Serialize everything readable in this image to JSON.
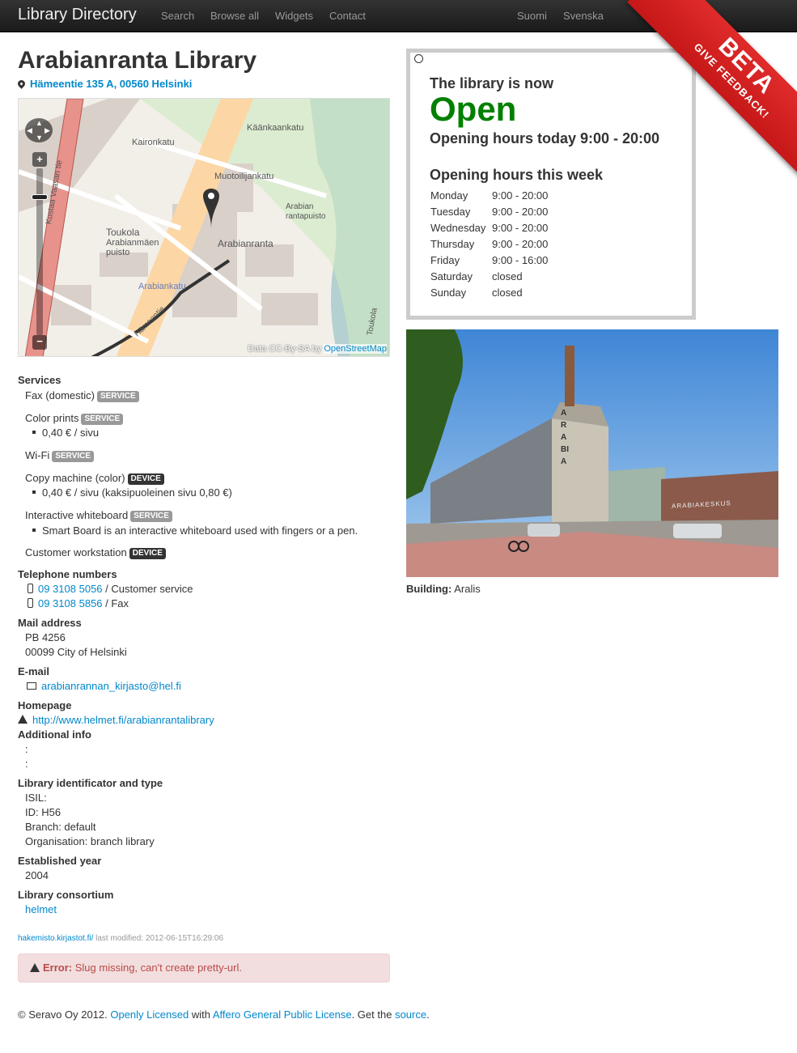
{
  "navbar": {
    "brand": "Library Directory",
    "links": [
      "Search",
      "Browse all",
      "Widgets",
      "Contact"
    ],
    "languages": [
      "Suomi",
      "Svenska"
    ]
  },
  "ribbon": {
    "beta": "BETA",
    "feedback": "GIVE FEEDBACK!"
  },
  "library": {
    "name": "Arabianranta Library",
    "address": "Hämeentie 135 A, 00560 Helsinki"
  },
  "map": {
    "labels": [
      "Käänkaankatu",
      "Kaironkatu",
      "Muotoilijankatu",
      "Toukola",
      "Arabianmäen puisto",
      "Arabianranta",
      "Arabian rantapuisto",
      "Arabiankatu",
      "Hämeentie",
      "Kustaa Vaasan tie",
      "Toukola"
    ],
    "attribution": "Data CC-By-SA by",
    "attribution_link": "OpenStreetMap"
  },
  "services": {
    "heading": "Services",
    "items": [
      {
        "name": "Fax (domestic)",
        "type": "SERVICE",
        "details": []
      },
      {
        "name": "Color prints",
        "type": "SERVICE",
        "details": [
          "0,40 € / sivu"
        ]
      },
      {
        "name": "Wi-Fi",
        "type": "SERVICE",
        "details": []
      },
      {
        "name": "Copy machine (color)",
        "type": "DEVICE",
        "details": [
          "0,40 € / sivu (kaksipuoleinen sivu 0,80 €)"
        ]
      },
      {
        "name": "Interactive whiteboard",
        "type": "SERVICE",
        "details": [
          "Smart Board is an interactive whiteboard used with fingers or a pen."
        ]
      },
      {
        "name": "Customer workstation",
        "type": "DEVICE",
        "details": []
      }
    ]
  },
  "telephone": {
    "heading": "Telephone numbers",
    "numbers": [
      {
        "number": "09 3108 5056",
        "label": " / Customer service"
      },
      {
        "number": "09 3108 5856",
        "label": " / Fax"
      }
    ]
  },
  "mail": {
    "heading": "Mail address",
    "line1": "PB 4256",
    "line2": "00099 City of Helsinki"
  },
  "email": {
    "heading": "E-mail",
    "address": "arabianrannan_kirjasto@hel.fi"
  },
  "homepage": {
    "heading": "Homepage",
    "url": "http://www.helmet.fi/arabianrantalibrary"
  },
  "additional": {
    "heading": "Additional info",
    "line1": ":",
    "line2": ":"
  },
  "identificator": {
    "heading": "Library identificator and type",
    "isil": "ISIL:",
    "id": "ID: H56",
    "branch": "Branch: default",
    "organisation": "Organisation: branch library"
  },
  "established": {
    "heading": "Established year",
    "year": "2004"
  },
  "consortium": {
    "heading": "Library consortium",
    "name": "helmet"
  },
  "meta": {
    "source": "hakemisto.kirjastot.fi/",
    "modified": " last modified: 2012-06-15T16:29:06"
  },
  "alert": {
    "label": "Error:",
    "message": " Slug missing, can't create pretty-url."
  },
  "footer": {
    "prefix": "© Seravo Oy 2012. ",
    "link1": "Openly Licensed",
    "mid": " with ",
    "link2": "Affero General Public License",
    "mid2": ". Get the ",
    "link3": "source",
    "end": "."
  },
  "hours": {
    "status": "The library is now",
    "open": "Open",
    "today": "Opening hours today 9:00 - 20:00",
    "week_heading": "Opening hours this week",
    "week": [
      {
        "day": "Monday",
        "time": "9:00 - 20:00"
      },
      {
        "day": "Tuesday",
        "time": "9:00 - 20:00"
      },
      {
        "day": "Wednesday",
        "time": "9:00 - 20:00"
      },
      {
        "day": "Thursday",
        "time": "9:00 - 20:00"
      },
      {
        "day": "Friday",
        "time": "9:00 - 16:00"
      },
      {
        "day": "Saturday",
        "time": "closed"
      },
      {
        "day": "Sunday",
        "time": "closed"
      }
    ]
  },
  "photo": {
    "sign": "ARABIA",
    "sign2": "ARABIAKESKUS"
  },
  "building": {
    "label": "Building:",
    "value": "Aralis"
  },
  "colors": {
    "accent": "#0088cc",
    "open": "#008000",
    "ribbon": "#d42222",
    "error_bg": "#f2dede"
  }
}
